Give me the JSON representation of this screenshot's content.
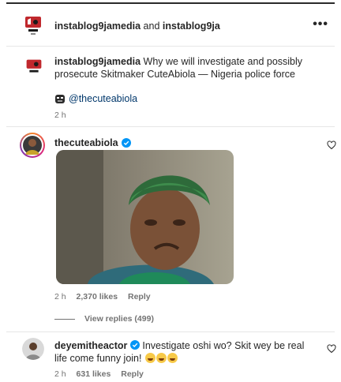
{
  "header": {
    "account_a": "instablog9jamedia",
    "and_text": "and",
    "account_b": "instablog9ja",
    "more_label": "•••"
  },
  "caption": {
    "username": "instablog9jamedia",
    "text": "Why we will investigate and possibly prosecute Skitmaker CuteAbiola — Nigeria police force",
    "mention": "@thecuteabiola",
    "time": "2 h"
  },
  "comments": [
    {
      "username": "thecuteabiola",
      "verified": true,
      "time": "2 h",
      "likes": "2,370 likes",
      "reply_label": "Reply",
      "view_replies": "View replies (499)"
    },
    {
      "username": "deyemitheactor",
      "verified": true,
      "text": "Investigate oshi wo? Skit wey be real life come funny join!",
      "emoji_count": 3,
      "time": "2 h",
      "likes": "631 likes",
      "reply_label": "Reply"
    }
  ],
  "colors": {
    "text": "#262626",
    "muted": "#737373",
    "link": "#00376b",
    "verified": "#0095f6"
  }
}
